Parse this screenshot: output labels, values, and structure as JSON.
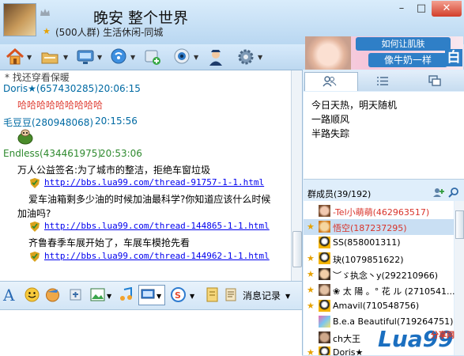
{
  "header": {
    "title": "晚安 整个世界",
    "subtitle": "(500人群) 生活休闲-同城"
  },
  "ad": {
    "line1": "如何让肌肤",
    "line2": "像牛奶一样",
    "badge": "白"
  },
  "chat": {
    "partial_line": "* 找还穿看保暖",
    "messages": [
      {
        "sender": "Doris★(657430285)",
        "time": "20:06:15",
        "text": "哈哈哈哈哈哈哈哈哈"
      },
      {
        "sender": "毛豆豆(280948068)",
        "time": "20:15:56"
      },
      {
        "sender": "Endless(434461975)",
        "time": "20:53:06",
        "lines": [
          "万人公益签名:为了城市的整洁，拒绝车窗垃圾",
          "http://bbs.lua99.com/thread-91757-1-1.html",
          "爱车油箱剩多少油的时候加油最科学?你知道应该什么时候",
          "加油吗?",
          "http://bbs.lua99.com/thread-144865-1-1.html",
          "齐鲁春季车展开始了，车展车模抢先看",
          "http://bbs.lua99.com/thread-144962-1-1.html"
        ]
      }
    ]
  },
  "inputbar": {
    "history_label": "消息记录"
  },
  "notice": {
    "lines": [
      "今日天热，明天随机",
      "一路顺风",
      "半路失踪"
    ]
  },
  "members": {
    "header": "群成员(39/192)",
    "list": [
      {
        "name": "-Tel小萌萌(462963517)",
        "color": "#d9342b",
        "star": false
      },
      {
        "name": "悟空(187237295)",
        "color": "#d9342b",
        "star": true
      },
      {
        "name": "SS(858001311)",
        "color": "#000000",
        "star": false
      },
      {
        "name": "玦(1079851622)",
        "color": "#000000",
        "star": true
      },
      {
        "name": "︶ゞ执念丶y(292210966)",
        "color": "#000000",
        "star": true
      },
      {
        "name": "❀ 太 陽 。° 花 ル (2710541...",
        "color": "#000000",
        "star": true
      },
      {
        "name": "Amavil(710548756)",
        "color": "#000000",
        "star": true
      },
      {
        "name": "B.e.a Beautiful(719264751)",
        "color": "#000000",
        "star": false
      },
      {
        "name": "ch大王",
        "color": "#000000",
        "star": false
      },
      {
        "name": "Doris★",
        "color": "#000000",
        "star": true
      }
    ]
  },
  "watermark": {
    "text": "Lua99",
    "suffix": "分享网"
  }
}
